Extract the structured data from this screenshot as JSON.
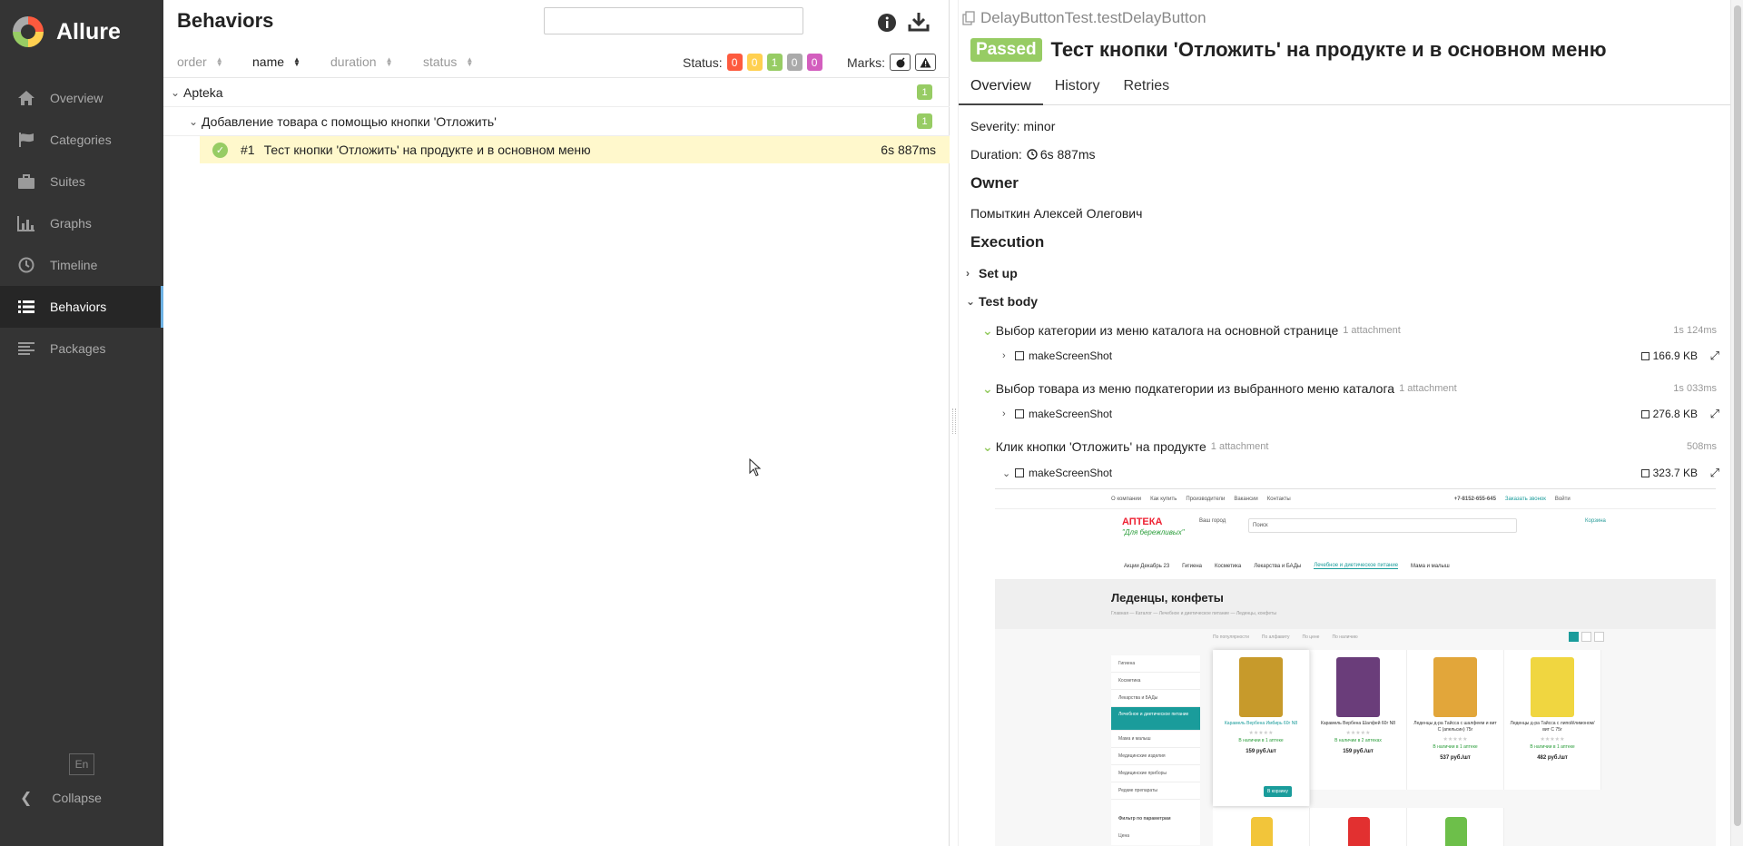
{
  "app": {
    "name": "Allure"
  },
  "sidebar": {
    "items": [
      {
        "label": "Overview",
        "icon": "home-icon"
      },
      {
        "label": "Categories",
        "icon": "flag-icon"
      },
      {
        "label": "Suites",
        "icon": "briefcase-icon"
      },
      {
        "label": "Graphs",
        "icon": "bar-chart-icon"
      },
      {
        "label": "Timeline",
        "icon": "clock-icon"
      },
      {
        "label": "Behaviors",
        "icon": "list-icon",
        "active": true
      },
      {
        "label": "Packages",
        "icon": "align-left-icon"
      }
    ],
    "language": "En",
    "collapse_label": "Collapse"
  },
  "left": {
    "title": "Behaviors",
    "search": {
      "value": "",
      "placeholder": ""
    },
    "sort": [
      {
        "label": "order"
      },
      {
        "label": "name",
        "active": true
      },
      {
        "label": "duration"
      },
      {
        "label": "status"
      }
    ],
    "status_label": "Status:",
    "status_counts": [
      {
        "value": "0",
        "color": "#fd5a3e"
      },
      {
        "value": "0",
        "color": "#ffd050"
      },
      {
        "value": "1",
        "color": "#97cc64"
      },
      {
        "value": "0",
        "color": "#aaaaaa"
      },
      {
        "value": "0",
        "color": "#d35ebe"
      }
    ],
    "marks_label": "Marks:",
    "tree": {
      "epic": {
        "name": "Apteka",
        "count": "1"
      },
      "feature": {
        "name": "Добавление товара с помощью кнопки 'Отложить'",
        "count": "1"
      },
      "test": {
        "order": "#1",
        "name": "Тест кнопки 'Отложить' на продукте и в основном меню",
        "duration": "6s 887ms"
      }
    }
  },
  "right": {
    "fullname": "DelayButtonTest.testDelayButton",
    "status": "Passed",
    "title": "Тест кнопки 'Отложить' на продукте и в основном меню",
    "tabs": [
      "Overview",
      "History",
      "Retries"
    ],
    "severity": "Severity: minor",
    "duration": "Duration:",
    "duration_value": "6s 887ms",
    "owner_heading": "Owner",
    "owner": "Помыткин Алексей Олегович",
    "execution_heading": "Execution",
    "setup_label": "Set up",
    "body_label": "Test body",
    "steps": [
      {
        "name": "Выбор категории из меню каталога на основной странице",
        "attachments": "1 attachment",
        "time": "1s 124ms",
        "att_name": "makeScreenShot",
        "att_size": "166.9 KB"
      },
      {
        "name": "Выбор товара из меню подкатегории из выбранного меню каталога",
        "attachments": "1 attachment",
        "time": "1s 033ms",
        "att_name": "makeScreenShot",
        "att_size": "276.8 KB"
      },
      {
        "name": "Клик кнопки 'Отложить' на продукте",
        "attachments": "1 attachment",
        "time": "508ms",
        "att_name": "makeScreenShot",
        "att_size": "323.7 KB"
      }
    ]
  },
  "screenshot": {
    "topbar": [
      "О компании",
      "Как купить",
      "Производители",
      "Вакансии",
      "Контакты",
      "+7-8152-655-645",
      "Заказать звонок",
      "Войти"
    ],
    "brand": "АПТЕКА",
    "brand_sub": "\"Для бережливых\"",
    "city": "Ваш город",
    "search_placeholder": "Поиск",
    "cart": "Корзина",
    "menu": [
      "Акции Декабрь 23",
      "Гигиена",
      "Косметика",
      "Лекарства и БАДы",
      "Лечебное и диетическое питание",
      "Мама и малыш"
    ],
    "page_title": "Леденцы, конфеты",
    "breadcrumb": "Главная — Каталог — Лечебное и диетическое питание — Леденцы, конфеты",
    "categories": [
      "Гигиена",
      "Косметика",
      "Лекарства и БАДы",
      "Лечебное и диетическое питание",
      "Мама и малыш",
      "Медицинские изделия",
      "Медицинские приборы",
      "Редкие препараты"
    ],
    "filter_title": "Фильтр по параметрам",
    "price_label": "Цена",
    "filters": [
      "По популярности",
      "По алфавиту",
      "По цене",
      "По наличию"
    ],
    "products": [
      {
        "name": "Карамель Вербена Имбирь 60г N8",
        "stock": "В наличии в 1 аптеке",
        "price": "159 руб./шт",
        "color": "#c79a2b"
      },
      {
        "name": "Карамель Вербена Шалфей 60г N8",
        "stock": "В наличии в 2 аптеках",
        "price": "159 руб./шт",
        "color": "#6a3d7a"
      },
      {
        "name": "Леденцы д-ра Тайсса с шалфеем и вит С (апельсин) 75г",
        "stock": "В наличии в 1 аптеке",
        "price": "537 руб./шт",
        "color": "#e2a63a"
      },
      {
        "name": "Леденцы д-ра Тайсса с липой/лимоном/вит С 75г",
        "stock": "В наличии в 1 аптеке",
        "price": "482 руб./шт",
        "color": "#f0d640"
      }
    ],
    "buy_label": "В корзину"
  }
}
